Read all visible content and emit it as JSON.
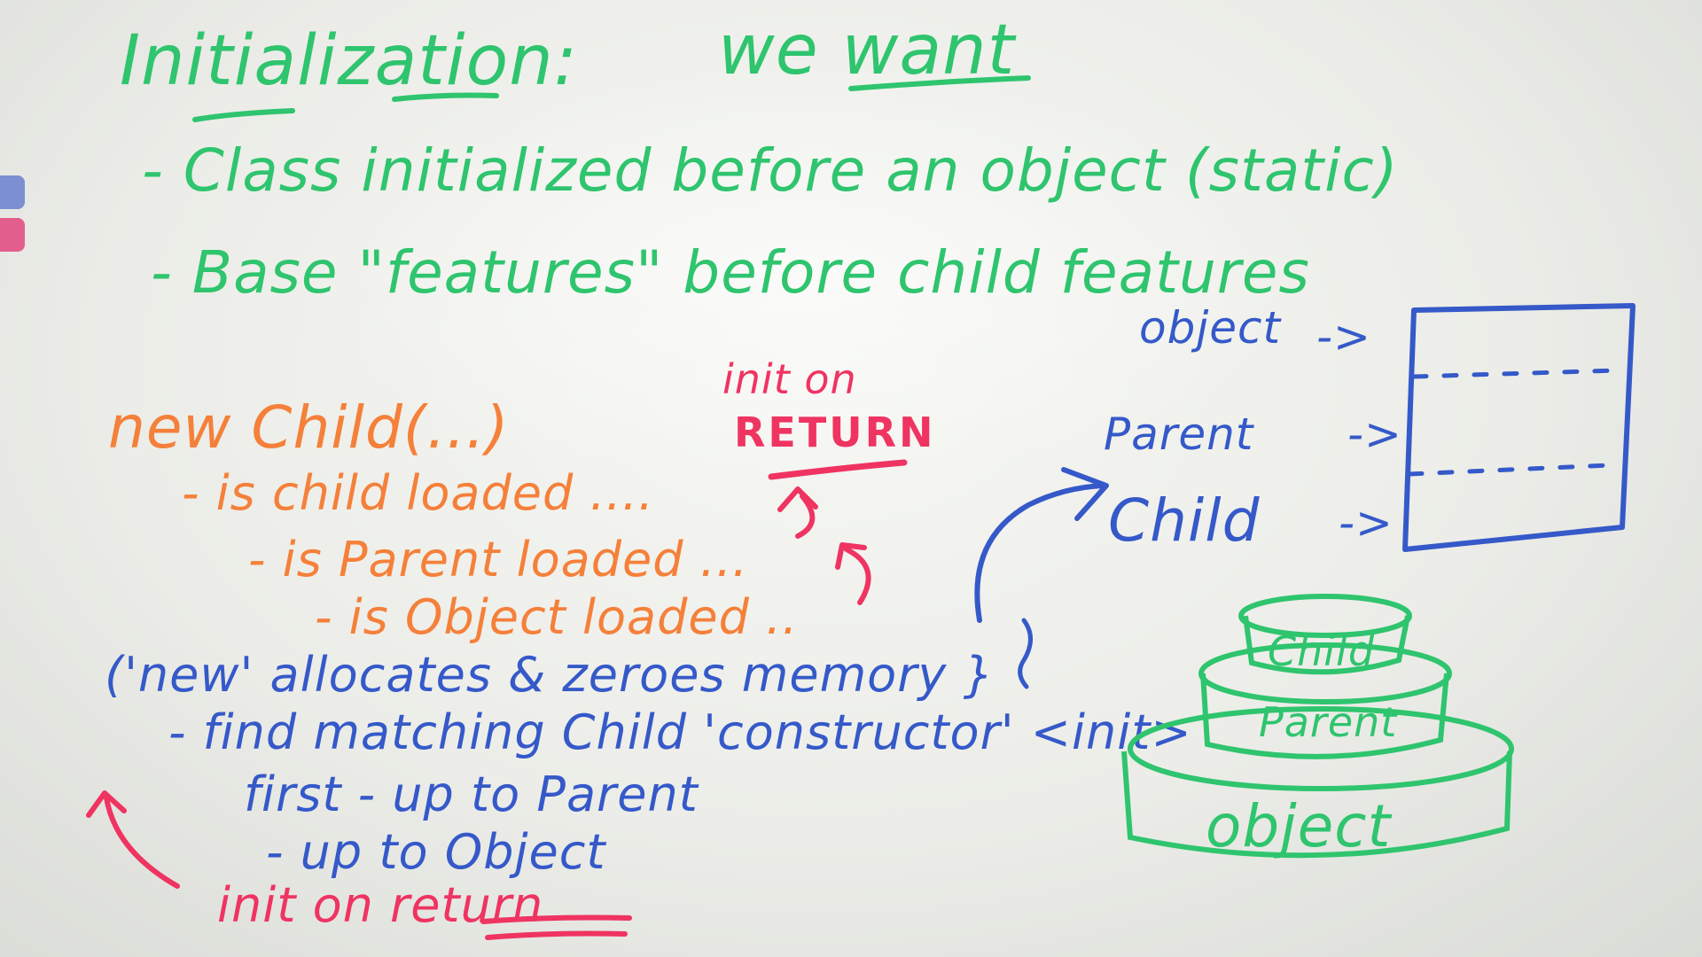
{
  "header": {
    "title": "Initialization:",
    "we_want": "we want"
  },
  "goals": [
    "- Class initialized before an object (static)",
    "- Base \"features\" before child features"
  ],
  "orange_block": {
    "new_child": "new Child(...)",
    "steps": [
      "- is child loaded ....",
      "- is Parent loaded ...",
      "- is Object loaded .."
    ]
  },
  "red_note_top": {
    "line1": "init on",
    "line2": "RETURN"
  },
  "blue_block": {
    "line1": "('new' allocates & zeroes memory }",
    "line2": "- find matching Child 'constructor' <init>",
    "line3": "first - up to Parent",
    "line4": "- up to Object"
  },
  "red_note_bottom": "init on return",
  "memory_diagram": {
    "labels": [
      "object",
      "Parent",
      "Child"
    ],
    "arrow": "->"
  },
  "cake_diagram": {
    "layers": [
      "Child",
      "Parent",
      "object"
    ]
  },
  "colors": {
    "green": "#2fc46e",
    "orange": "#f5803a",
    "red": "#ef3462",
    "blue": "#3559c9"
  }
}
